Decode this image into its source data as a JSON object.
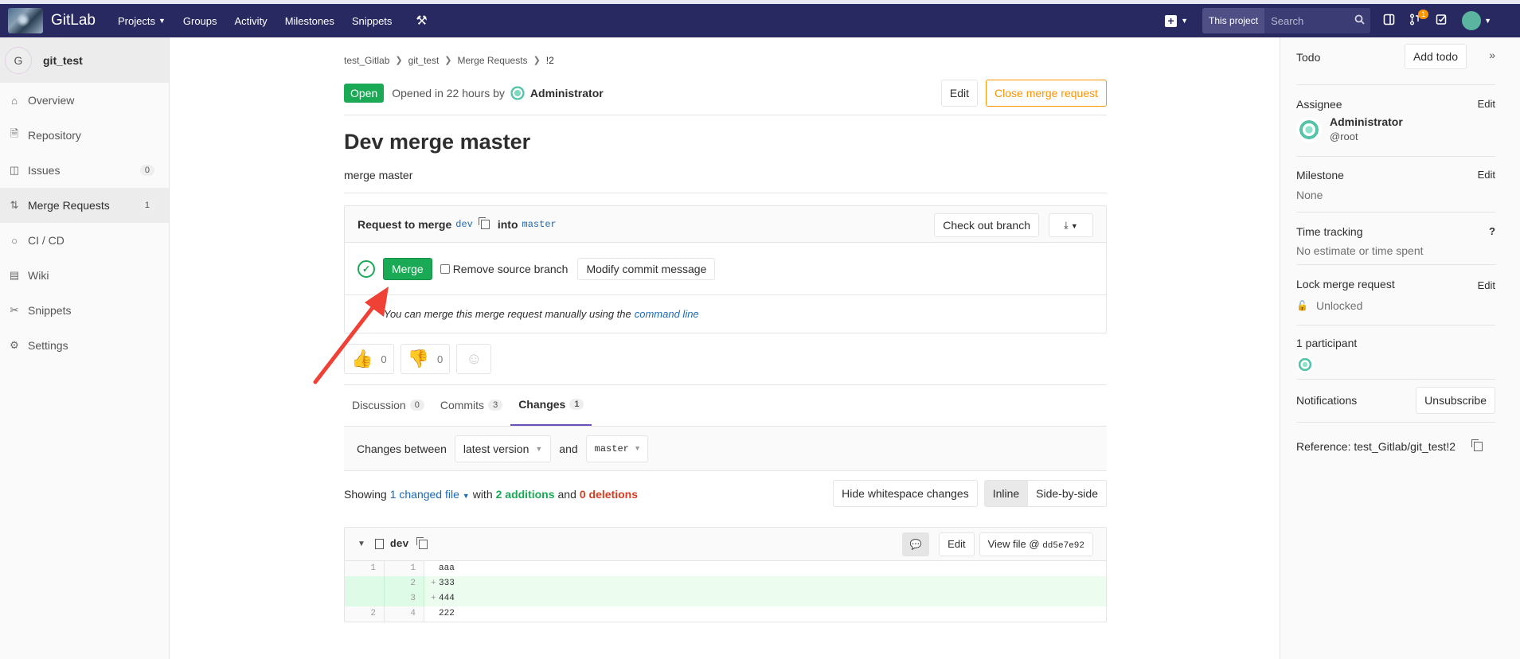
{
  "navbar": {
    "brand": "GitLab",
    "links": [
      {
        "label": "Projects",
        "dropdown": true
      },
      {
        "label": "Groups",
        "dropdown": false
      },
      {
        "label": "Activity",
        "dropdown": false
      },
      {
        "label": "Milestones",
        "dropdown": false
      },
      {
        "label": "Snippets",
        "dropdown": false
      }
    ],
    "search_scope": "This project",
    "search_placeholder": "Search",
    "mr_badge": "1",
    "header_bg": "#292961"
  },
  "sidebar": {
    "project_initial": "G",
    "project_name": "git_test",
    "items": [
      {
        "label": "Overview",
        "icon": "home-icon",
        "count": ""
      },
      {
        "label": "Repository",
        "icon": "repo-icon",
        "count": ""
      },
      {
        "label": "Issues",
        "icon": "issues-icon",
        "count": "0"
      },
      {
        "label": "Merge Requests",
        "icon": "merge-request-icon",
        "count": "1"
      },
      {
        "label": "CI / CD",
        "icon": "ci-icon",
        "count": ""
      },
      {
        "label": "Wiki",
        "icon": "book-icon",
        "count": ""
      },
      {
        "label": "Snippets",
        "icon": "scissors-icon",
        "count": ""
      },
      {
        "label": "Settings",
        "icon": "gear-icon",
        "count": ""
      }
    ]
  },
  "breadcrumb": [
    "test_Gitlab",
    "git_test",
    "Merge Requests",
    "!2"
  ],
  "mr": {
    "status": "Open",
    "opened_text": "Opened in 22 hours by",
    "author": "Administrator",
    "edit_label": "Edit",
    "close_label": "Close merge request",
    "title": "Dev merge master",
    "description": "merge master"
  },
  "widget": {
    "request_prefix": "Request to merge",
    "source_branch": "dev",
    "into_label": "into",
    "target_branch": "master",
    "checkout_label": "Check out branch",
    "merge_label": "Merge",
    "remove_source_label": "Remove source branch",
    "modify_commit_label": "Modify commit message",
    "manual_text": "You can merge this merge request manually using the",
    "command_line_link": "command line"
  },
  "awards": {
    "thumbs_up": "0",
    "thumbs_down": "0"
  },
  "tabs": [
    {
      "label": "Discussion",
      "count": "0"
    },
    {
      "label": "Commits",
      "count": "3"
    },
    {
      "label": "Changes",
      "count": "1"
    }
  ],
  "compare": {
    "prefix": "Changes between",
    "version": "latest version",
    "and_label": "and",
    "target": "master"
  },
  "files_summary": {
    "showing": "Showing",
    "changed_files": "1 changed file",
    "with": "with",
    "additions": "2 additions",
    "and": "and",
    "deletions": "0 deletions",
    "hide_ws_label": "Hide whitespace changes",
    "inline_label": "Inline",
    "side_by_side_label": "Side-by-side"
  },
  "diff_file": {
    "name": "dev",
    "edit_label": "Edit",
    "view_file_label": "View file @",
    "commit_sha": "dd5e7e92",
    "lines": [
      {
        "old": "1",
        "new": "1",
        "type": "context",
        "prefix": " ",
        "text": "aaa"
      },
      {
        "old": "",
        "new": "2",
        "type": "added",
        "prefix": "+",
        "text": "333"
      },
      {
        "old": "",
        "new": "3",
        "type": "added",
        "prefix": "+",
        "text": "444"
      },
      {
        "old": "2",
        "new": "4",
        "type": "context",
        "prefix": " ",
        "text": "222"
      }
    ]
  },
  "right_sidebar": {
    "todo_label": "Todo",
    "add_todo_label": "Add todo",
    "assignee_title": "Assignee",
    "assignee_name": "Administrator",
    "assignee_username": "@root",
    "milestone_title": "Milestone",
    "milestone_value": "None",
    "time_tracking_title": "Time tracking",
    "time_tracking_value": "No estimate or time spent",
    "lock_title": "Lock merge request",
    "lock_value": "Unlocked",
    "participants_title": "1 participant",
    "notifications_title": "Notifications",
    "unsubscribe_label": "Unsubscribe",
    "reference_label": "Reference: test_Gitlab/git_test!2",
    "edit_label": "Edit"
  }
}
